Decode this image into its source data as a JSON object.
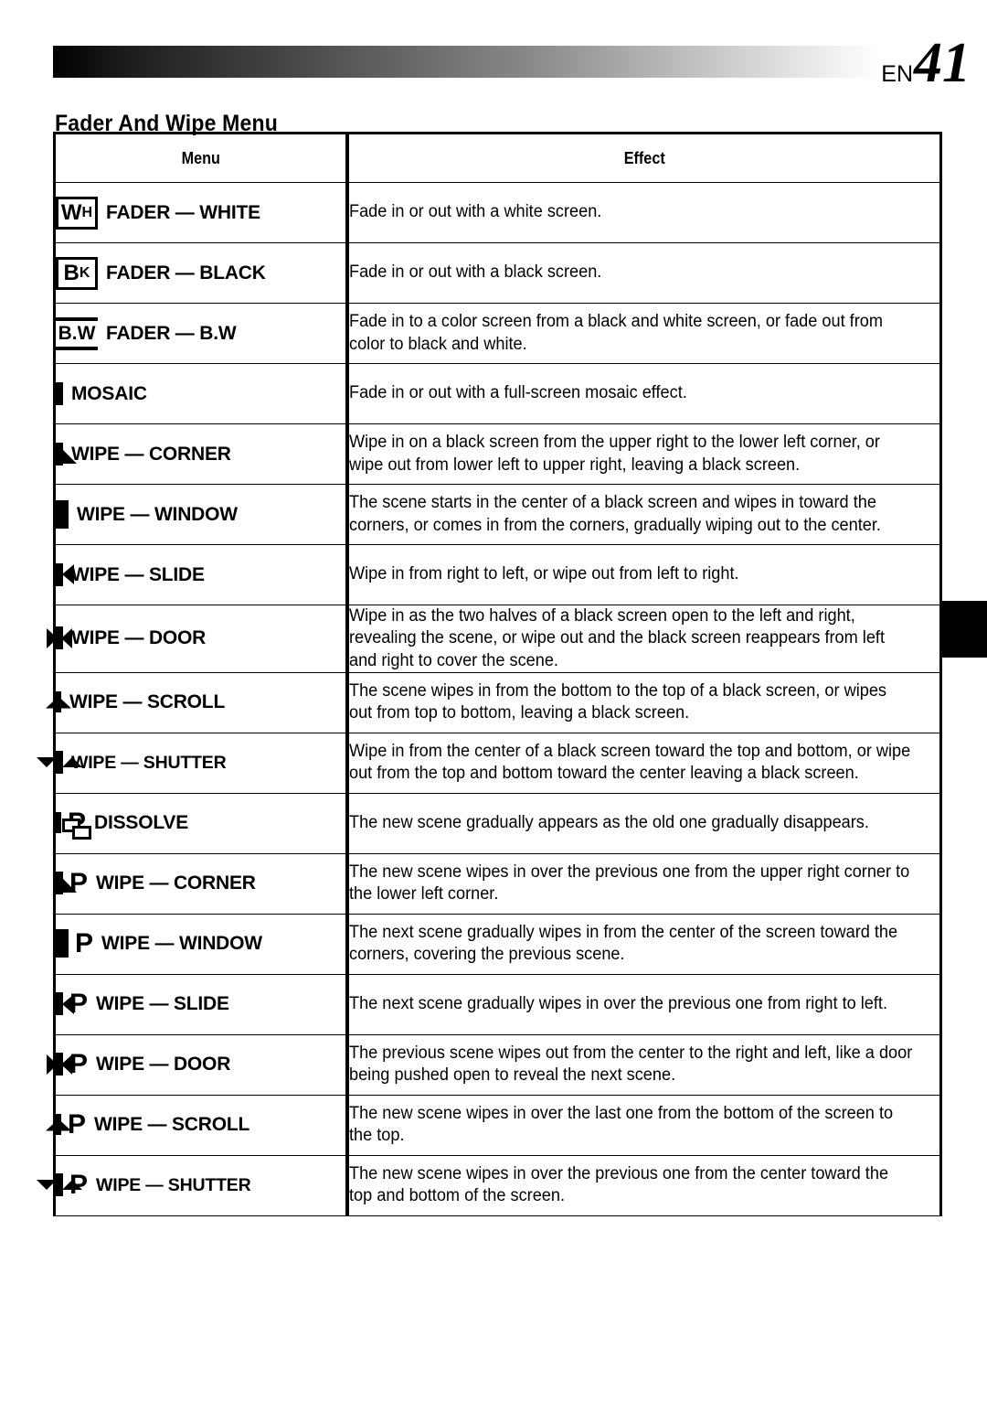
{
  "header": {
    "lang": "EN",
    "page_number": "41",
    "gradient_from": "#000000",
    "gradient_to": "#ffffff"
  },
  "title": "Fader And Wipe Menu",
  "table": {
    "columns": [
      "Menu",
      "Effect"
    ],
    "rows": [
      {
        "icon": "fader-white-icon",
        "label": "FADER — WHITE",
        "effect": "Fade in or out with a white screen."
      },
      {
        "icon": "fader-black-icon",
        "label": "FADER — BLACK",
        "effect": "Fade in or out with a black screen."
      },
      {
        "icon": "fader-bw-icon",
        "label": "FADER — B.W",
        "effect": "Fade in to a color screen from a black and white screen, or fade out from color to black and white."
      },
      {
        "icon": "mosaic-icon",
        "label": "MOSAIC",
        "effect": "Fade in or out with a full-screen mosaic effect."
      },
      {
        "icon": "wipe-corner-icon",
        "label": "WIPE — CORNER",
        "effect": "Wipe in on a black screen from the upper right to the lower left corner, or wipe out from lower left to upper right, leaving a black screen."
      },
      {
        "icon": "wipe-window-icon",
        "label": "WIPE — WINDOW",
        "effect": "The scene starts in the center of a black screen and wipes in toward the corners, or comes in from the corners, gradually wiping out to the center."
      },
      {
        "icon": "wipe-slide-icon",
        "label": "WIPE — SLIDE",
        "effect": "Wipe in from right to left, or wipe out from left to right."
      },
      {
        "icon": "wipe-door-icon",
        "label": "WIPE — DOOR",
        "effect": "Wipe in as the two halves of a black screen open to the left and right, revealing the scene, or wipe out and the black screen reappears from left and right to cover the scene."
      },
      {
        "icon": "wipe-scroll-icon",
        "label": "WIPE — SCROLL",
        "effect": "The scene wipes in from the bottom to the top of a black screen, or wipes out from top to bottom, leaving a black screen."
      },
      {
        "icon": "wipe-shutter-icon",
        "label": "WIPE — SHUTTER",
        "effect": "Wipe in from the center of a black screen toward the top and bottom, or wipe out from the top and bottom toward the center leaving a black screen."
      },
      {
        "icon": "dissolve-p-icon",
        "label": "DISSOLVE",
        "p_suffix": "P",
        "effect": "The new scene gradually appears as the old one gradually disappears."
      },
      {
        "icon": "wipe-corner-p-icon",
        "label": "WIPE — CORNER",
        "p_suffix": "P",
        "effect": "The new scene wipes in over the previous one from the upper right corner to the lower left corner."
      },
      {
        "icon": "wipe-window-p-icon",
        "label": "WIPE — WINDOW",
        "p_suffix": "P",
        "effect": "The next scene gradually wipes in from the center of the screen toward the corners, covering the previous scene."
      },
      {
        "icon": "wipe-slide-p-icon",
        "label": "WIPE — SLIDE",
        "p_suffix": "P",
        "effect": "The next scene gradually wipes in over the previous one from right to left."
      },
      {
        "icon": "wipe-door-p-icon",
        "label": "WIPE — DOOR",
        "p_suffix": "P",
        "effect": "The previous scene wipes out from the center to the right and left, like a door being pushed open to reveal the next scene."
      },
      {
        "icon": "wipe-scroll-p-icon",
        "label": "WIPE — SCROLL",
        "p_suffix": "P",
        "effect": "The new scene wipes in over the last one from the bottom of the screen to the top."
      },
      {
        "icon": "wipe-shutter-p-icon",
        "label": "WIPE — SHUTTER",
        "p_suffix": "P",
        "effect": "The new scene wipes in over the previous one from the center toward the top and bottom of the screen."
      }
    ]
  },
  "icon_text": {
    "wh_big": "W",
    "wh_small": "H",
    "bk_big": "B",
    "bk_small": "K",
    "bw": "B.W"
  }
}
